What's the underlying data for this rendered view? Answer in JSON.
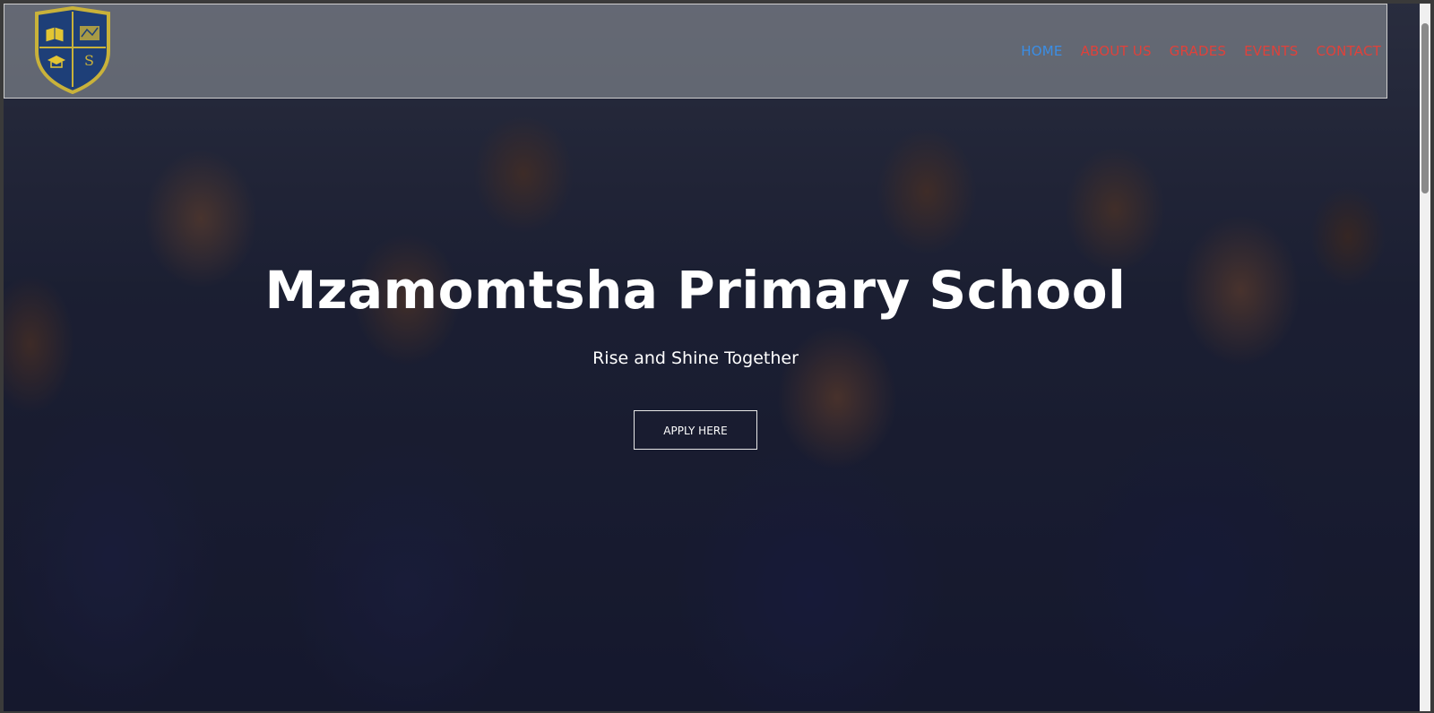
{
  "nav": {
    "items": [
      {
        "label": "HOME",
        "active": true
      },
      {
        "label": "ABOUT US",
        "active": false
      },
      {
        "label": "GRADES",
        "active": false
      },
      {
        "label": "EVENTS",
        "active": false
      },
      {
        "label": "CONTACT",
        "active": false
      }
    ],
    "active_color": "#3a8ee6",
    "link_color": "#e0413a"
  },
  "logo": {
    "icon": "school-crest-icon",
    "letter": "S",
    "colors": {
      "shield": "#1e3f78",
      "border": "#c9b23a"
    }
  },
  "hero": {
    "title": "Mzamomtsha Primary School",
    "subtitle": "Rise and Shine Together",
    "cta_label": "APPLY HERE"
  }
}
